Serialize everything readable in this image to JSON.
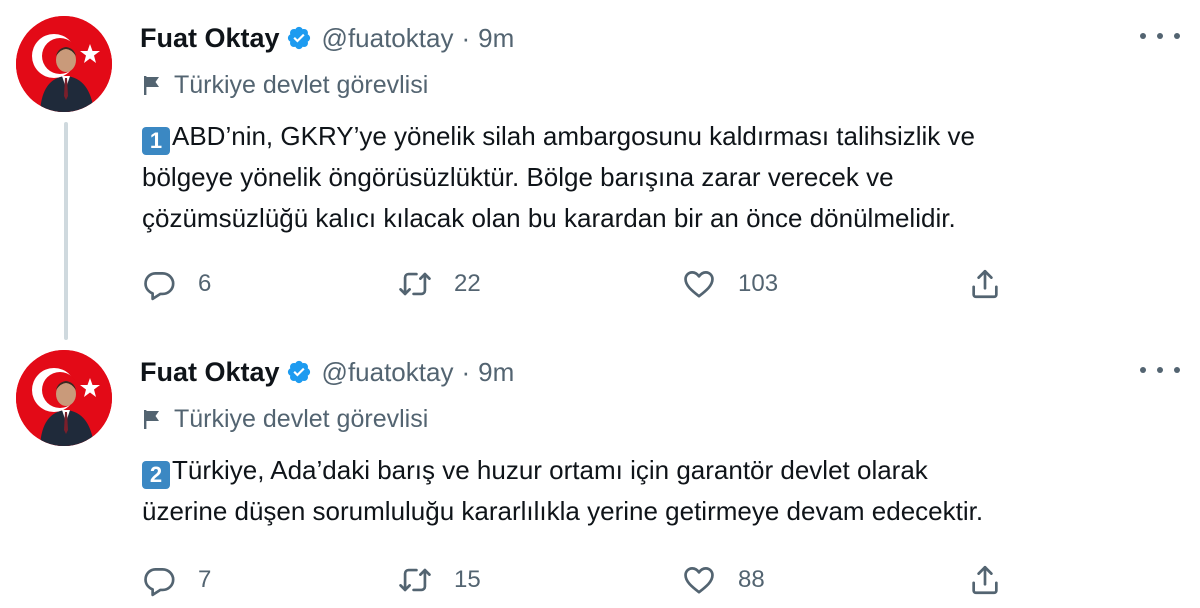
{
  "tweets": [
    {
      "name": "Fuat Oktay",
      "handle": "@fuatoktay",
      "separator": "·",
      "time": "9m",
      "label": "Türkiye devlet görevlisi",
      "keycap": "1",
      "text_lines": [
        "ABD’nin, GKRY’ye yönelik silah ambargosunu kaldırması talihsizlik ve",
        "bölgeye yönelik öngörüsüzlüktür. Bölge barışına zarar verecek ve",
        "çözümsüzlüğü kalıcı kılacak olan bu karardan bir an önce dönülmelidir."
      ],
      "replies": "6",
      "retweets": "22",
      "likes": "103"
    },
    {
      "name": "Fuat Oktay",
      "handle": "@fuatoktay",
      "separator": "·",
      "time": "9m",
      "label": "Türkiye devlet görevlisi",
      "keycap": "2",
      "text_lines": [
        "Türkiye, Ada’daki barış ve huzur ortamı için garantör devlet olarak",
        "üzerine düşen sorumluluğu kararlılıkla yerine getirmeye devam edecektir."
      ],
      "replies": "7",
      "retweets": "15",
      "likes": "88"
    }
  ],
  "icons": {
    "verified": "verified-badge-icon",
    "label": "flag-icon",
    "reply": "reply-icon",
    "retweet": "retweet-icon",
    "like": "heart-icon",
    "share": "share-icon",
    "more": "more-options-icon"
  },
  "colors": {
    "verified_blue": "#1d9bf0",
    "secondary_text": "#536471",
    "keycap_blue": "#3b88c3",
    "avatar_red": "#e30a17"
  }
}
